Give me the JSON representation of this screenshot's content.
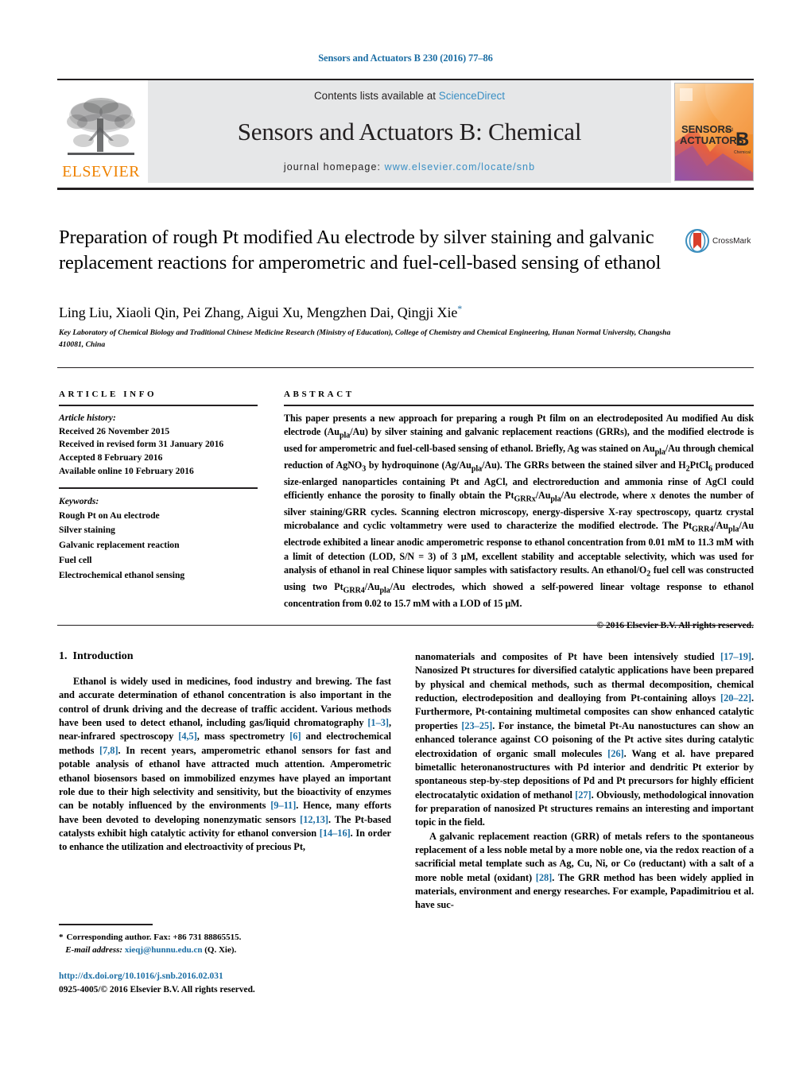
{
  "running_head": "Sensors and Actuators B 230 (2016) 77–86",
  "masthead": {
    "publisher_wordmark": "ELSEVIER",
    "contents_prefix": "Contents lists available at ",
    "contents_link": "ScienceDirect",
    "journal_title": "Sensors and Actuators B: Chemical",
    "homepage_prefix": "journal homepage: ",
    "homepage_url": "www.elsevier.com/locate/snb",
    "cover_line1": "SENSORS",
    "cover_and": "and",
    "cover_line2": "ACTUATORS",
    "cover_letter": "B",
    "cover_sub": "Chemical",
    "colors": {
      "link_blue": "#3a8fc4",
      "elsevier_orange": "#ef8200",
      "masthead_gray": "#e6e7e8"
    }
  },
  "article": {
    "title": "Preparation of rough Pt modified Au electrode by silver staining and galvanic replacement reactions for amperometric and fuel-cell-based sensing of ethanol",
    "crossmark_label": "CrossMark",
    "authors": "Ling Liu, Xiaoli Qin, Pei Zhang, Aigui Xu, Mengzhen Dai, Qingji Xie",
    "author_star": "*",
    "affiliation": "Key Laboratory of Chemical Biology and Traditional Chinese Medicine Research (Ministry of Education), College of Chemistry and Chemical Engineering, Hunan Normal University, Changsha 410081, China"
  },
  "article_info": {
    "heading": "ARTICLE INFO",
    "history_label": "Article history:",
    "history": [
      "Received 26 November 2015",
      "Received in revised form 31 January 2016",
      "Accepted 8 February 2016",
      "Available online 10 February 2016"
    ],
    "keywords_label": "Keywords:",
    "keywords": [
      "Rough Pt on Au electrode",
      "Silver staining",
      "Galvanic replacement reaction",
      "Fuel cell",
      "Electrochemical ethanol sensing"
    ]
  },
  "abstract": {
    "heading": "ABSTRACT",
    "copyright": "© 2016 Elsevier B.V. All rights reserved."
  },
  "introduction": {
    "heading_number": "1.",
    "heading_text": "Introduction"
  },
  "footnote": {
    "star": "*",
    "corresponding": "Corresponding author. Fax: +86 731 88865515.",
    "email_label": "E-mail address:",
    "email": "xieqj@hunnu.edu.cn",
    "email_owner": "(Q. Xie)."
  },
  "doi": {
    "url": "http://dx.doi.org/10.1016/j.snb.2016.02.031",
    "issn_line": "0925-4005/© 2016 Elsevier B.V. All rights reserved."
  }
}
